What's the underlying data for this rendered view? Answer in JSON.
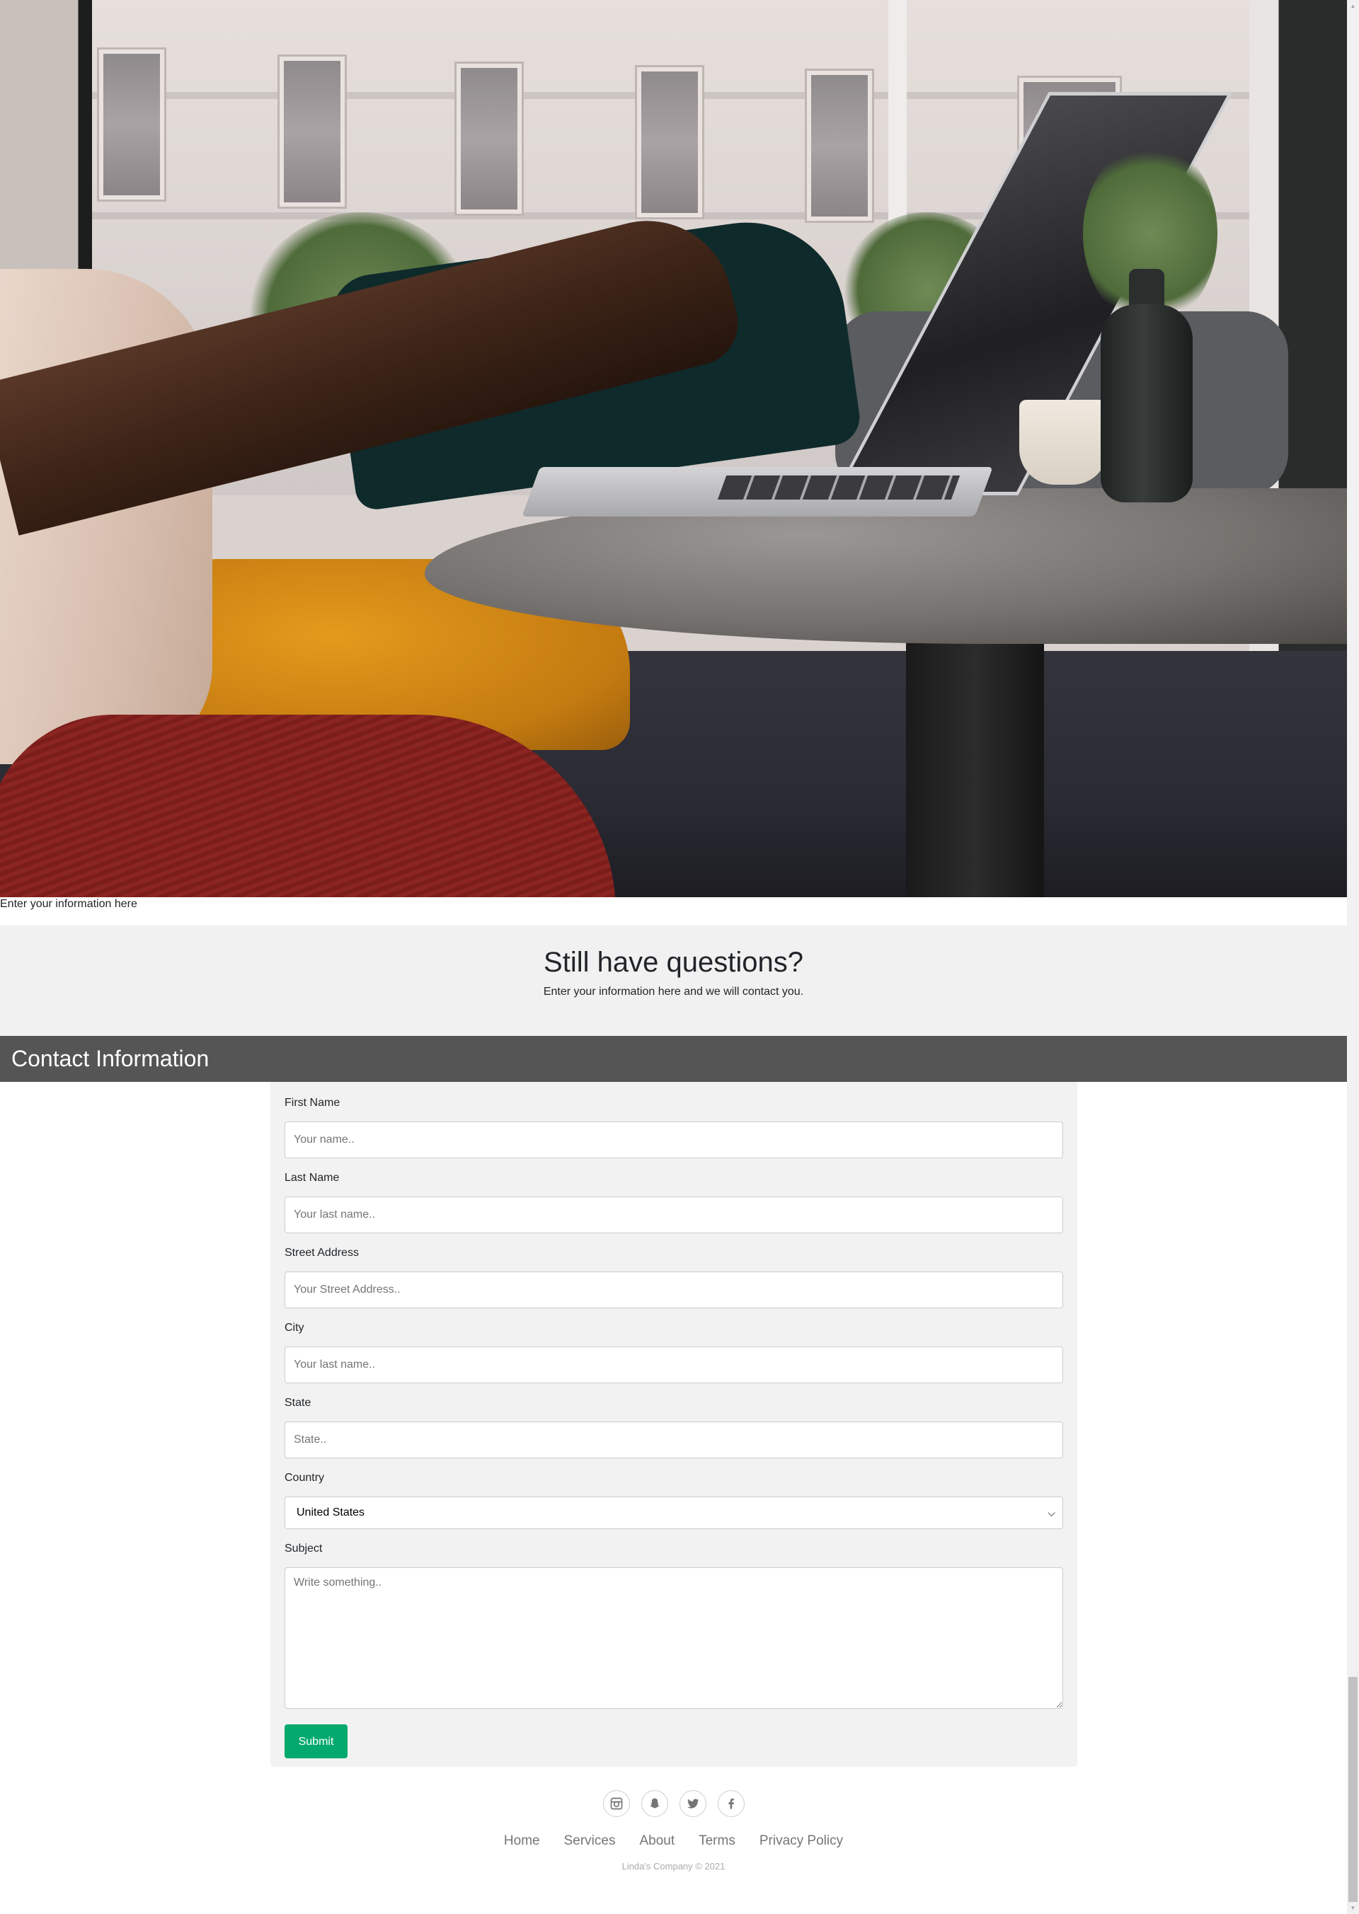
{
  "hero": {
    "image_alt": "Person typing on a laptop at a cafe table by a window"
  },
  "caption": "Enter your information here",
  "questions": {
    "title": "Still have questions?",
    "subtitle": "Enter your information here and we will contact you."
  },
  "contact": {
    "header": "Contact Information"
  },
  "form": {
    "first_name": {
      "label": "First Name",
      "placeholder": "Your name.."
    },
    "last_name": {
      "label": "Last Name",
      "placeholder": "Your last name.."
    },
    "street": {
      "label": "Street Address",
      "placeholder": "Your Street Address.."
    },
    "city": {
      "label": "City",
      "placeholder": "Your last name.."
    },
    "state": {
      "label": "State",
      "placeholder": "State.."
    },
    "country": {
      "label": "Country",
      "selected": "United States"
    },
    "subject": {
      "label": "Subject",
      "placeholder": "Write something.."
    },
    "submit_label": "Submit"
  },
  "footer": {
    "social": [
      {
        "icon": "instagram-icon"
      },
      {
        "icon": "snapchat-icon"
      },
      {
        "icon": "twitter-icon"
      },
      {
        "icon": "facebook-icon"
      }
    ],
    "links": [
      "Home",
      "Services",
      "About",
      "Terms",
      "Privacy Policy"
    ],
    "copyright": "Linda's Company © 2021"
  },
  "colors": {
    "accent": "#04aa6d",
    "header_bg": "#555555",
    "banner_bg": "#f1f1f1",
    "form_bg": "#f2f2f2"
  }
}
